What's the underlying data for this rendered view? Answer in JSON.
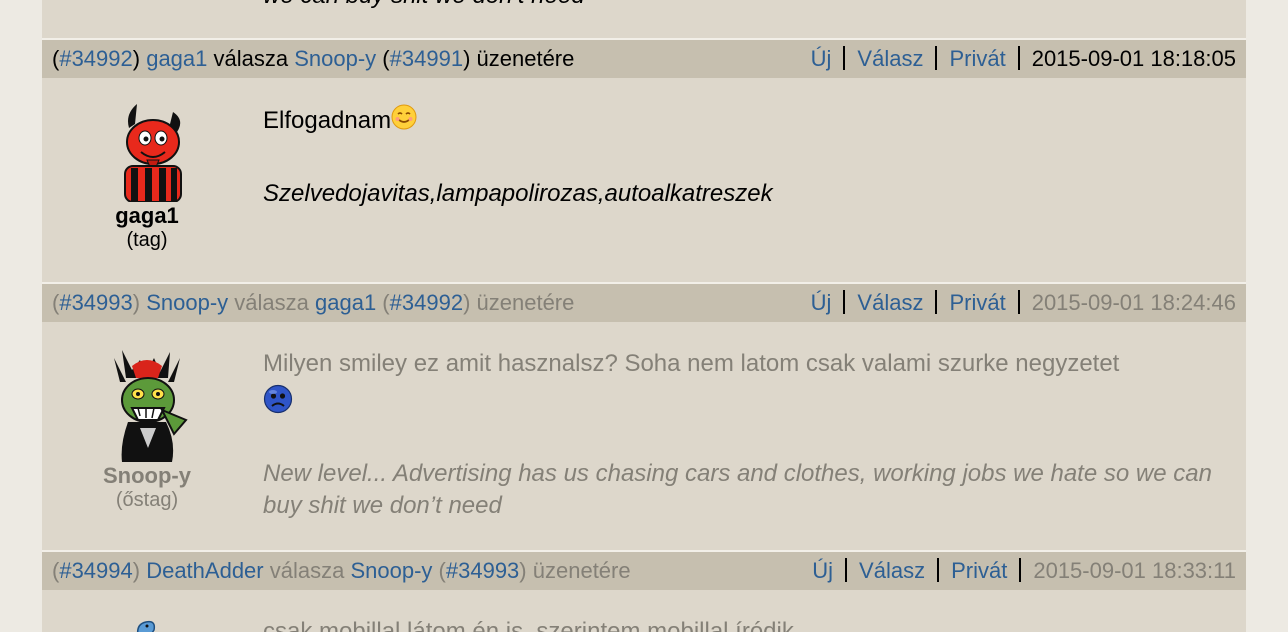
{
  "top_signature": "we can buy shit we don’t need",
  "posts": [
    {
      "id": "#34992",
      "user": "gaga1",
      "reply_word": "válasza",
      "reply_to_user": "Snoop-y",
      "reply_to_id": "#34991",
      "reply_suffix": "üzenetére",
      "actions": {
        "new": "Új",
        "reply": "Válasz",
        "private": "Privát"
      },
      "timestamp": "2015-09-01 18:18:05",
      "username": "gaga1",
      "rank": "(tag)",
      "message": "Elfogadnam",
      "signature": "Szelvedojavitas,lampapolirozas,autoalkatreszek"
    },
    {
      "id": "#34993",
      "user": "Snoop-y",
      "reply_word": "válasza",
      "reply_to_user": "gaga1",
      "reply_to_id": "#34992",
      "reply_suffix": "üzenetére",
      "actions": {
        "new": "Új",
        "reply": "Válasz",
        "private": "Privát"
      },
      "timestamp": "2015-09-01 18:24:46",
      "username": "Snoop-y",
      "rank": "(őstag)",
      "message": "Milyen smiley ez amit hasznalsz? Soha nem latom csak valami szurke negyzetet",
      "signature": "New level... Advertising has us chasing cars and clothes, working jobs we hate so we can buy shit we don’t need"
    },
    {
      "id": "#34994",
      "user": "DeathAdder",
      "reply_word": "válasza",
      "reply_to_user": "Snoop-y",
      "reply_to_id": "#34993",
      "reply_suffix": "üzenetére",
      "actions": {
        "new": "Új",
        "reply": "Válasz",
        "private": "Privát"
      },
      "timestamp": "2015-09-01 18:33:11",
      "message": "csak mobillal látom én is, szerintem mobillal íródik"
    }
  ]
}
